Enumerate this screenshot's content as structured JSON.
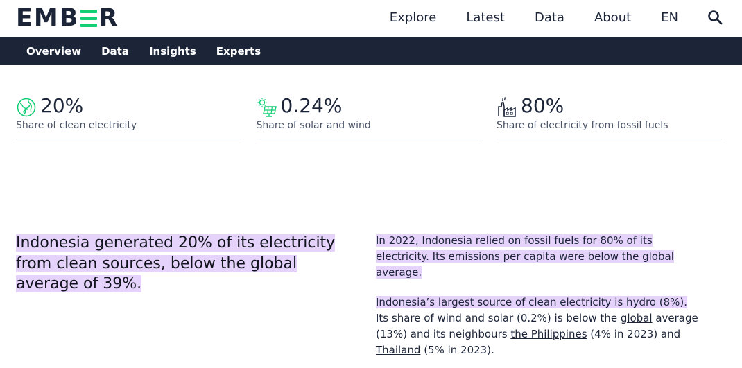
{
  "header": {
    "logo_text": "EMBER",
    "nav": [
      "Explore",
      "Latest",
      "Data",
      "About",
      "EN"
    ],
    "search_icon": "search-icon"
  },
  "subnav": [
    "Overview",
    "Data",
    "Insights",
    "Experts"
  ],
  "stats": [
    {
      "icon": "globe-leaf-icon",
      "value": "20%",
      "label": "Share of clean electricity"
    },
    {
      "icon": "solar-panel-icon",
      "value": "0.24%",
      "label": "Share of solar and wind"
    },
    {
      "icon": "factory-icon",
      "value": "80%",
      "label": "Share of electricity from fossil fuels"
    }
  ],
  "lead": "Indonesia generated 20% of its electricity from clean sources, below the global average of 39%.",
  "body": {
    "p1": "In 2022, Indonesia relied on fossil fuels for 80% of its electricity. Its emissions per capita were below the global average.",
    "p2_highlight": "Indonesia’s largest source of clean electricity is hydro (8%).",
    "p2_a": " Its share of wind and solar (0.2%) is below the ",
    "p2_link1": "global",
    "p2_b": " average (13%) and its neighbours ",
    "p2_link2": "the Philippines",
    "p2_c": " (4% in 2023) and ",
    "p2_link3": "Thailand",
    "p2_d": " (5% in 2023)."
  },
  "colors": {
    "brand_navy": "#1c2438",
    "brand_green": "#13ce74",
    "highlight": "#e6d3fb"
  }
}
